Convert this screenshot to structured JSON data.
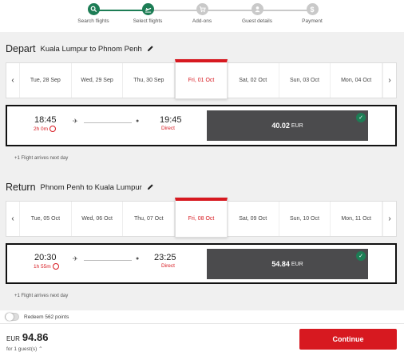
{
  "stepper": {
    "steps": [
      {
        "label": "Search flights",
        "icon": "search-icon",
        "state": "done"
      },
      {
        "label": "Select flights",
        "icon": "plane-icon",
        "state": "active"
      },
      {
        "label": "Add-ons",
        "icon": "cart-icon",
        "state": "todo"
      },
      {
        "label": "Guest details",
        "icon": "user-icon",
        "state": "todo"
      },
      {
        "label": "Payment",
        "icon": "dollar-icon",
        "state": "todo"
      }
    ],
    "colors": {
      "done": "#1d7d55",
      "todo": "#c9c9c9"
    }
  },
  "depart": {
    "heading": "Depart",
    "route": "Kuala Lumpur to Phnom Penh",
    "dates": [
      "Tue, 28 Sep",
      "Wed, 29 Sep",
      "Thu, 30 Sep",
      "Fri, 01 Oct",
      "Sat, 02 Oct",
      "Sun, 03 Oct",
      "Mon, 04 Oct"
    ],
    "selected_date": "Fri, 01 Oct",
    "flight": {
      "depart_time": "18:45",
      "duration": "2h 0m",
      "arrive_time": "19:45",
      "stops": "Direct",
      "price": "40.02",
      "currency": "EUR"
    },
    "note": "+1 Flight arrives next day"
  },
  "return": {
    "heading": "Return",
    "route": "Phnom Penh to Kuala Lumpur",
    "dates": [
      "Tue, 05 Oct",
      "Wed, 06 Oct",
      "Thu, 07 Oct",
      "Fri, 08 Oct",
      "Sat, 09 Oct",
      "Sun, 10 Oct",
      "Mon, 11 Oct"
    ],
    "selected_date": "Fri, 08 Oct",
    "flight": {
      "depart_time": "20:30",
      "duration": "1h 55m",
      "arrive_time": "23:25",
      "stops": "Direct",
      "price": "54.84",
      "currency": "EUR"
    },
    "note": "+1 Flight arrives next day"
  },
  "redeem": {
    "label": "Redeem 562 points"
  },
  "total": {
    "currency": "EUR",
    "amount": "94.86",
    "guests": "for 1 guest(s)"
  },
  "continue_label": "Continue",
  "colors": {
    "accent": "#d71920",
    "price_bg": "#4b4b4d",
    "check": "#1d7d55"
  }
}
